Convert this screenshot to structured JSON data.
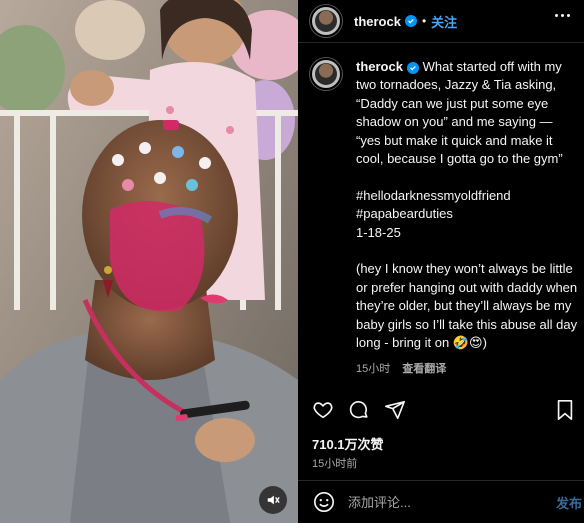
{
  "post": {
    "username": "therock",
    "follow_label": "关注",
    "separator": "•",
    "caption_text": "What started off with my two tornadoes, Jazzy & Tia asking, “Daddy can we just put some eye shadow on you” and me saying — “yes but make it quick and make it cool, because I gotta go to the gym”\n\n#hellodarknessmyoldfriend\n#papabearduties\n1-18-25\n\n(hey I know they won’t always be little or prefer hanging out with daddy when they’re older, but they’ll always be my baby girls so I’ll take this abuse all day long - bring it on 🤣😍)",
    "comment_time": "15小时",
    "translate_label": "查看翻译",
    "likes": "710.1万次赞",
    "post_time": "15小时前",
    "comment_placeholder": "添加评论...",
    "post_button_label": "发布"
  },
  "icons": {
    "verified": "verified-badge-icon",
    "more": "more-options-icon",
    "like": "heart-icon",
    "comment": "comment-icon",
    "share": "share-icon",
    "save": "bookmark-icon",
    "emoji": "emoji-icon",
    "mute": "audio-muted-icon"
  },
  "colors": {
    "background": "#000000",
    "text": "#f5f5f5",
    "secondary_text": "#a8a8a8",
    "link_blue": "#4aa3f5",
    "verified_blue": "#0095f6",
    "divider": "#262626"
  }
}
